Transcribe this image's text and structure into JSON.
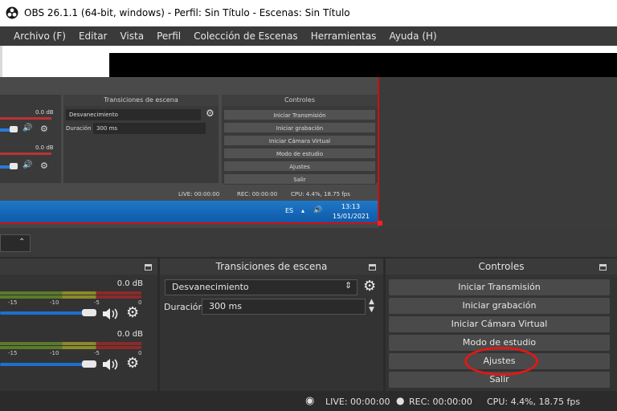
{
  "window": {
    "title": "OBS 26.1.1 (64-bit, windows) - Perfil: Sin Título - Escenas: Sin Título"
  },
  "menu": [
    "Archivo (F)",
    "Editar",
    "Vista",
    "Perfil",
    "Colección de Escenas",
    "Herramientas",
    "Ayuda (H)"
  ],
  "preview_inner": {
    "db1": "0.0 dB",
    "db2": "0.0 dB",
    "transitions_title": "Transiciones de escena",
    "controls_title": "Controles",
    "transition_value": "Desvanecimiento",
    "duration_label": "Duración",
    "duration_value": "300 ms",
    "buttons": [
      "Iniciar Transmisión",
      "Iniciar grabación",
      "Iniciar Cámara Virtual",
      "Modo de estudio",
      "Ajustes",
      "Salir"
    ],
    "status_live": "LIVE: 00:00:00",
    "status_rec": "REC: 00:00:00",
    "status_cpu": "CPU: 4.4%, 18.75 fps",
    "taskbar_lang": "ES",
    "taskbar_time": "13:13",
    "taskbar_date": "15/01/2021"
  },
  "mixer": {
    "db1": "0.0 dB",
    "db2": "0.0 dB",
    "ticks": [
      "-15",
      "-10",
      "-5",
      "0"
    ],
    "volume_1": 0.6,
    "volume_2": 0.6
  },
  "transitions": {
    "title": "Transiciones de escena",
    "selected": "Desvanecimiento",
    "duration_label": "Duración",
    "duration_value": "300 ms"
  },
  "controls": {
    "title": "Controles",
    "buttons": [
      "Iniciar Transmisión",
      "Iniciar grabación",
      "Iniciar Cámara Virtual",
      "Modo de estudio",
      "Ajustes",
      "Salir"
    ]
  },
  "status": {
    "live": "LIVE: 00:00:00",
    "rec": "REC: 00:00:00",
    "cpu": "CPU: 4.4%, 18.75 fps"
  },
  "colors": {
    "accent": "#1e6fd0",
    "highlight": "#e01818"
  }
}
